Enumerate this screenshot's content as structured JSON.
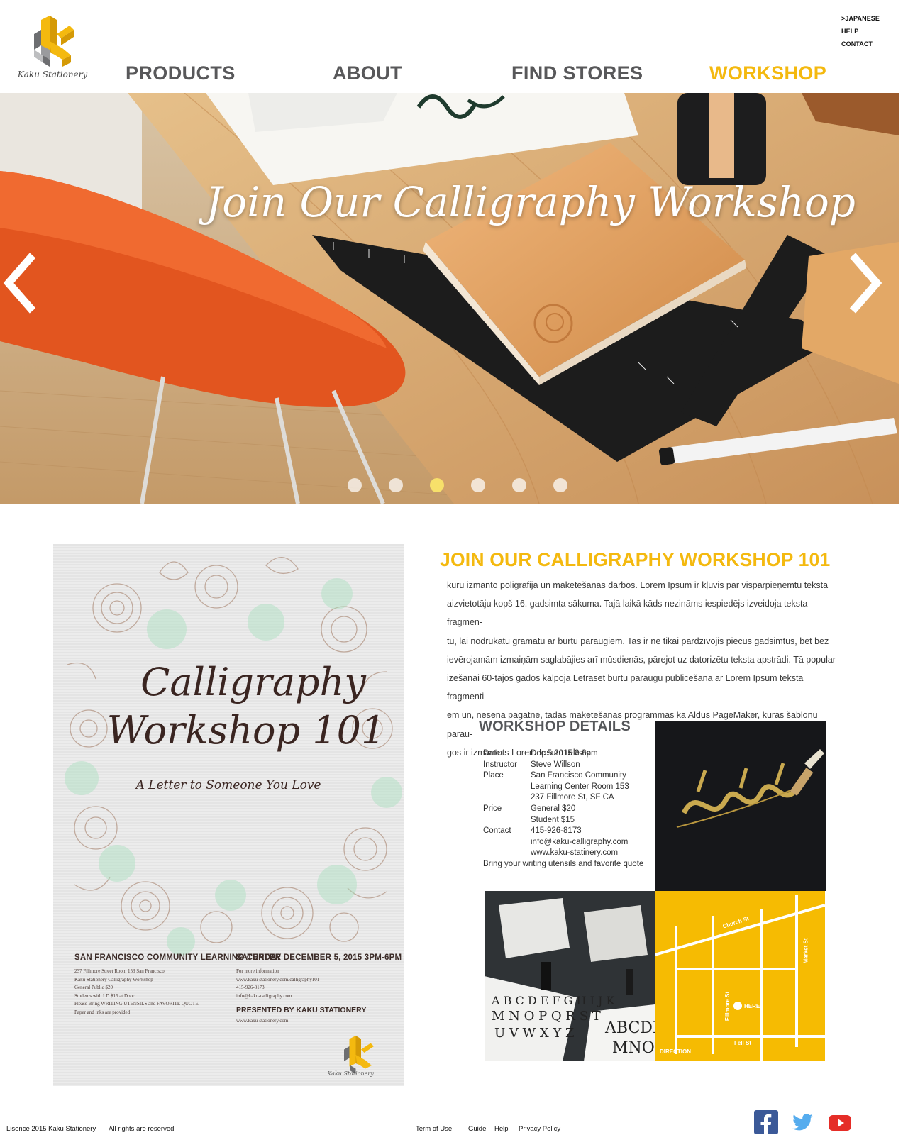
{
  "brand": {
    "name": "Kaku Stationery",
    "logo_icon": "k-cube-logo-icon",
    "accent_color": "#f4b90f"
  },
  "util_links": [
    ">JAPANESE",
    "HELP",
    "CONTACT"
  ],
  "nav": {
    "items": [
      "PRODUCTS",
      "ABOUT",
      "FIND STORES",
      "WORKSHOP"
    ],
    "active": "WORKSHOP"
  },
  "hero": {
    "title": "Join Our Calligraphy Workshop",
    "prev_icon": "chevron-left-icon",
    "next_icon": "chevron-right-icon",
    "slide_count": 6,
    "active_slide": 3
  },
  "poster": {
    "title_line1": "Calligraphy",
    "title_line2": "Workshop 101",
    "subtitle": "A Letter to Someone You Love",
    "venue_heading": "SAN FRANCISCO COMMUNITY LEARNING CENTER",
    "venue_lines": [
      "237 Fillmore Street Room 153 San Francisco",
      "Kaku Stationery Calligraphy Workshop",
      "General Public $20",
      "Students with I.D $15 at Door",
      "Please Bring WRITING UTENSILS and FAVORITE QUOTE",
      "Paper and inks are provided"
    ],
    "date_heading": "SATURDAY DECEMBER 5, 2015  3PM-6PM",
    "info_lines": [
      "For more information",
      "www.kaku-stationery.com/calligraphy101",
      "415-926-8173",
      "info@kaku-calligraphy.com"
    ],
    "presented_by": "PRESENTED BY KAKU STATIONERY",
    "presented_url": "www.kaku-stationery.com",
    "logo_text": "Kaku Stationery"
  },
  "article": {
    "title": "JOIN OUR CALLIGRAPHY WORKSHOP 101",
    "body_lines": [
      "kuru izmanto poligrāfijā un maketēšanas darbos. Lorem Ipsum ir kļuvis par vispārpieņemtu teksta",
      "aizvietotāju kopš 16. gadsimta sākuma. Tajā laikā kāds nezināms iespiedējs izveidoja teksta fragmen-",
      "tu, lai nodrukātu grāmatu ar burtu paraugiem. Tas ir ne tikai pārdzīvojis piecus gadsimtus, bet bez",
      "ievērojamām izmaiņām saglabājies arī mūsdienās, pārejot uz datorizētu teksta apstrādi. Tā popular-",
      "izēšanai 60-tajos gados kalpoja Letraset burtu paraugu publicēšana ar Lorem Ipsum teksta fragmenti-",
      "em un, nesenā pagātnē, tādas maketēšanas programmas kā Aldus PageMaker, kuras šablonu parau-",
      "gos ir izmantots Lorem Ipsum teksts."
    ]
  },
  "details": {
    "title": "WORKSHOP DETAILS",
    "rows": [
      {
        "label": "Date",
        "values": [
          "Dec 5 2015 3-6pm"
        ]
      },
      {
        "label": "Instructor",
        "values": [
          "Steve Willson"
        ]
      },
      {
        "label": "Place",
        "values": [
          "San Francisco Community",
          "Learning Center Room 153",
          "237 Fillmore St, SF CA"
        ]
      },
      {
        "label": "Price",
        "values": [
          "General  $20",
          "Student $15"
        ]
      },
      {
        "label": "Contact",
        "values": [
          "415-926-8173",
          "info@kaku-calligraphy.com",
          "www.kaku-statinery.com"
        ]
      }
    ],
    "note": "Bring your writing utensils and favorite quote"
  },
  "map": {
    "streets": [
      "Church St",
      "Market St",
      "Fillmore St",
      "Fell St"
    ],
    "here_label": "HERE",
    "direction_label": "DIRECTION"
  },
  "footer": {
    "licence": "Lisence 2015 Kaku Stationery",
    "rights": "All rights are reserved",
    "links": [
      "Term of Use",
      "Guide",
      "Help",
      "Privacy Policy"
    ],
    "social": [
      "facebook-icon",
      "twitter-icon",
      "youtube-icon"
    ]
  }
}
